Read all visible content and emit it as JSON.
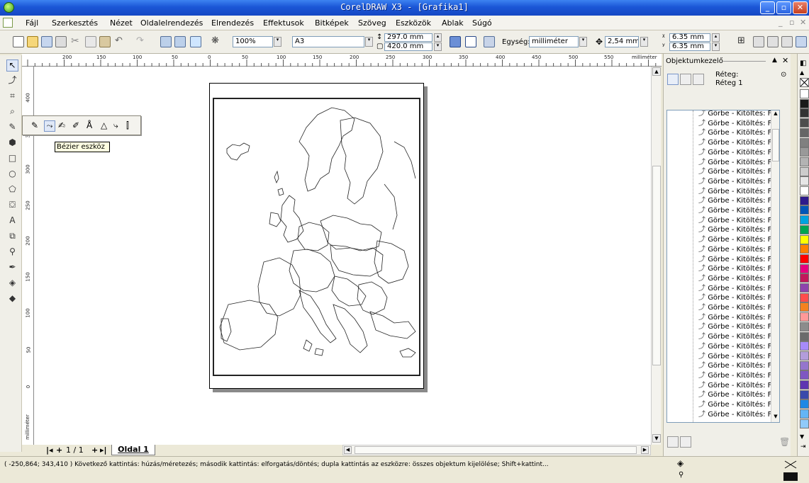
{
  "window": {
    "title": "CorelDRAW X3 - [Grafika1]"
  },
  "menu": [
    {
      "label": "Fájl"
    },
    {
      "label": "Szerkesztés"
    },
    {
      "label": "Nézet"
    },
    {
      "label": "Oldalelrendezés"
    },
    {
      "label": "Elrendezés"
    },
    {
      "label": "Effektusok"
    },
    {
      "label": "Bitképek"
    },
    {
      "label": "Szöveg"
    },
    {
      "label": "Eszközök"
    },
    {
      "label": "Ablak"
    },
    {
      "label": "Súgó"
    }
  ],
  "toolbar": {
    "zoom": "100%",
    "paper": "A3",
    "width": "297.0 mm",
    "height": "420.0 mm",
    "unit_label": "Egység:",
    "unit_value": "milliméter",
    "nudge": "2,54 mm",
    "dup_x": "6.35 mm",
    "dup_y": "6.35 mm"
  },
  "ruler": {
    "h_ticks": [
      "200",
      "150",
      "100",
      "50",
      "0",
      "50",
      "100",
      "150",
      "200",
      "250",
      "300",
      "350",
      "400",
      "450",
      "500",
      "550"
    ],
    "h_unit": "milliméter",
    "v_ticks": [
      "400",
      "350",
      "300",
      "250",
      "200",
      "150",
      "100",
      "50",
      "0"
    ],
    "v_unit": "milliméter"
  },
  "flyout": {
    "tooltip": "Bézier eszköz"
  },
  "docker": {
    "title": "Objektumkezelő",
    "layer_label": "Réteg:",
    "layer_name": "Réteg 1",
    "object_label": "Görbe - Kitöltés: F",
    "object_count_visible": 32
  },
  "pagenav": {
    "counter": "1 / 1",
    "tab": "Oldal 1"
  },
  "palette": [
    "#ffffff",
    "#1a1a1a",
    "#333333",
    "#4d4d4d",
    "#666666",
    "#808080",
    "#999999",
    "#b3b3b3",
    "#cccccc",
    "#e6e6e6",
    "#ffffff",
    "#2d1a8c",
    "#0057b8",
    "#00a3e0",
    "#00a651",
    "#ffff00",
    "#ff7f00",
    "#ff0000",
    "#e6007e",
    "#c2185b",
    "#8e44ad",
    "#ff4d4d",
    "#f58220",
    "#ff9999",
    "#8c8c8c",
    "#6b6b6b",
    "#a78bfa",
    "#b39ddb",
    "#9575cd",
    "#7e57c2",
    "#5e35b1",
    "#3949ab",
    "#1e88e5",
    "#64b5f6",
    "#90caf9"
  ],
  "status": {
    "text": "( -250,864; 343,410 )  Következő kattintás: húzás/méretezés; második kattintás: elforgatás/döntés; dupla kattintás az eszközre: összes objektum kijelölése; Shift+kattint..."
  }
}
